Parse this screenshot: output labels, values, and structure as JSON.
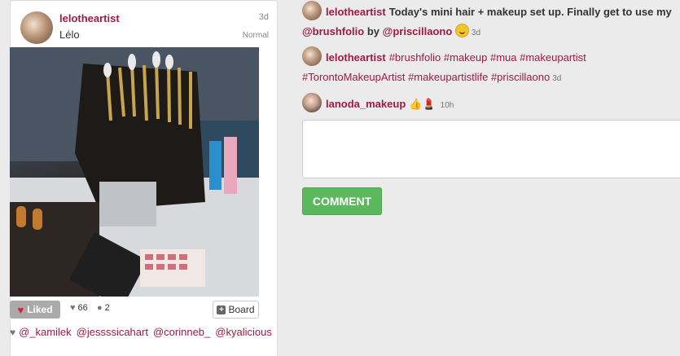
{
  "post": {
    "username": "lelotheartist",
    "display_name": "Lélo",
    "time": "3d",
    "filter": "Normal",
    "liked_label": "Liked",
    "likes_count": "66",
    "comments_count": "2",
    "board_label": "Board",
    "liked_by": [
      "@_kamilek",
      "@jessssicahart",
      "@corinneb_",
      "@kyalicious"
    ]
  },
  "comments": [
    {
      "username": "lelotheartist",
      "text_a": "Today's mini hair + makeup set up. Finally get to use my",
      "mention_1": "@brushfolio",
      "text_b": "by",
      "mention_2": "@priscillaono",
      "time": "3d"
    },
    {
      "username": "lelotheartist",
      "hashtags": "#brushfolio #makeup #mua #makeupartist #TorontoMakeupArtist #makeupartistlife #priscillaono",
      "time": "3d"
    },
    {
      "username": "lanoda_makeup",
      "emoji": "👍💄",
      "time": "10h"
    }
  ],
  "comment_box": {
    "placeholder": ""
  },
  "comment_button_label": "COMMENT",
  "colors": {
    "accent": "#9e1b43",
    "comment_button": "#5cb85c",
    "liked_button": "#aaaaaa"
  }
}
